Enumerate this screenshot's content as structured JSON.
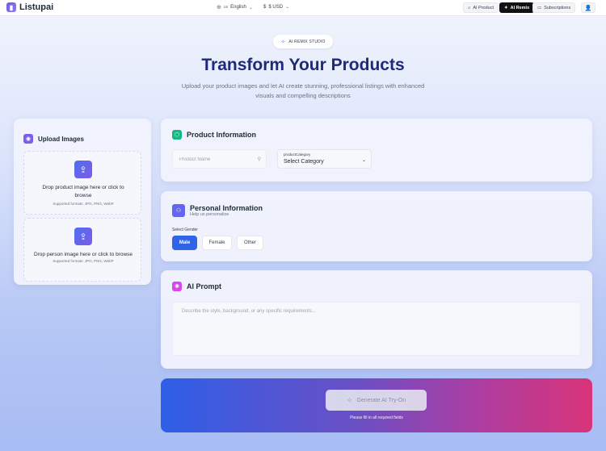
{
  "nav": {
    "brand": "Listupai",
    "language": {
      "code": "us",
      "label": "English"
    },
    "currency": {
      "symbol": "$",
      "label": "USD"
    },
    "buttons": {
      "ai_product": "AI Product",
      "ai_remix": "AI Remix",
      "subscriptions": "Subscriptions"
    }
  },
  "hero": {
    "badge": "AI REMIX STUDIO",
    "title": "Transform Your Products",
    "subtitle": "Upload your product images and let AI create stunning, professional listings with enhanced visuals and compelling descriptions"
  },
  "upload": {
    "title": "Upload Images",
    "product_drop": {
      "text": "Drop product image here or click to browse",
      "formats": "Supported formats: JPG, PNG, WebP"
    },
    "person_drop": {
      "text": "Drop person image here or click to browse",
      "formats": "Supported formats: JPG, PNG, WebP"
    }
  },
  "product_info": {
    "title": "Product Information",
    "name_placeholder": "Product Name",
    "category_label": "productCategory",
    "category_value": "Select Category"
  },
  "personal_info": {
    "title": "Personal Information",
    "subtitle": "Help us personalize",
    "gender_label": "Select Gender",
    "genders": [
      "Male",
      "Female",
      "Other"
    ],
    "selected_gender": "Male"
  },
  "prompt": {
    "title": "AI Prompt",
    "placeholder": "Describe the style, background, or any specific requirements..."
  },
  "generate": {
    "button": "Generate AI Try-On",
    "hint": "Please fill in all required fields"
  },
  "colors": {
    "primary": "#2f63e8",
    "title": "#1e2a78",
    "product_icon": "#10b981",
    "personal_icon": "#6366f1",
    "prompt_icon": "#d946ef"
  },
  "icons": {
    "globe": "globe-icon",
    "dollar": "dollar-icon",
    "chevron": "chevron-down-icon",
    "box": "box-icon",
    "sparkle": "sparkle-icon",
    "card": "credit-card-icon",
    "user": "user-icon",
    "camera": "camera-icon",
    "upload": "upload-icon",
    "cube": "cube-icon",
    "users": "users-icon"
  }
}
